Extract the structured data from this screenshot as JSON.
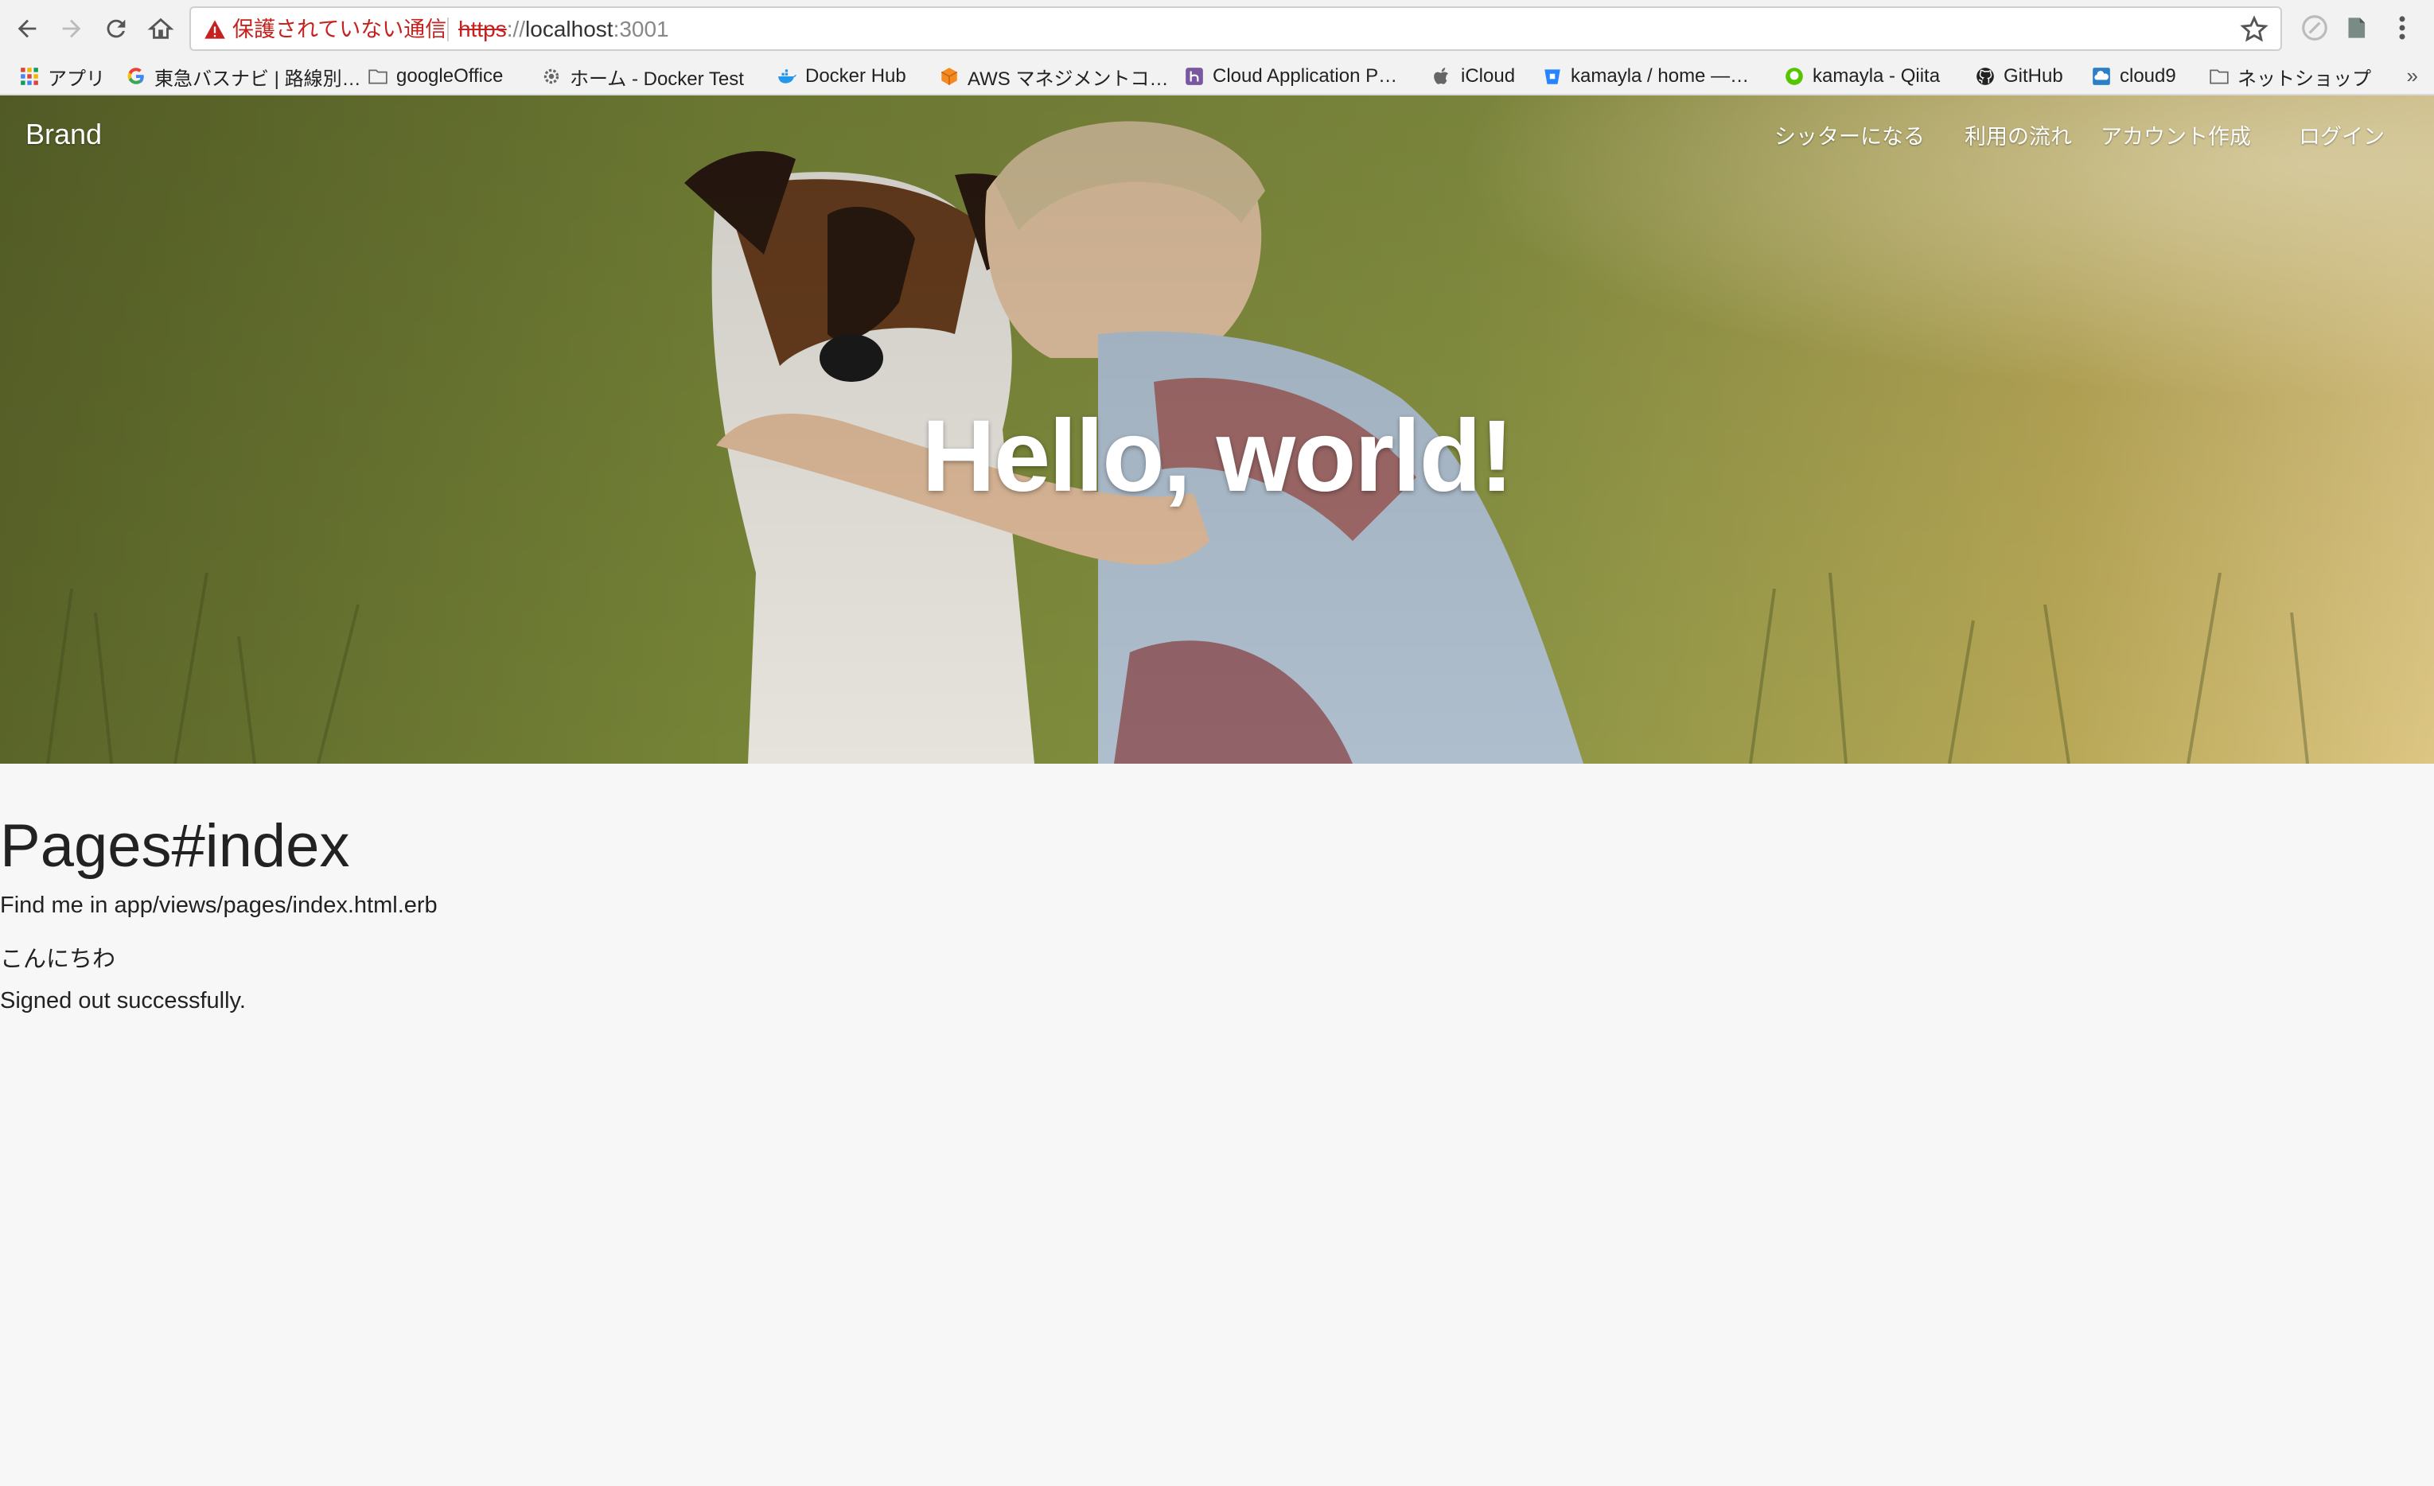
{
  "browser": {
    "security_warning": "保護されていない通信",
    "url_scheme": "https",
    "url_sep": "://",
    "url_host": "localhost",
    "url_port": ":3001"
  },
  "bookmarks": [
    {
      "label": "アプリ",
      "icon": "apps-grid-icon"
    },
    {
      "label": "東急バスナビ | 路線別…",
      "icon": "google-g-icon"
    },
    {
      "label": "googleOffice",
      "icon": "folder-icon"
    },
    {
      "label": "ホーム - Docker Test",
      "icon": "gear-icon"
    },
    {
      "label": "Docker Hub",
      "icon": "docker-whale-icon"
    },
    {
      "label": "AWS マネジメントコ…",
      "icon": "aws-cube-icon"
    },
    {
      "label": "Cloud Application P…",
      "icon": "heroku-icon"
    },
    {
      "label": "iCloud",
      "icon": "apple-icon"
    },
    {
      "label": "kamayla / home —…",
      "icon": "bitbucket-icon"
    },
    {
      "label": "kamayla - Qiita",
      "icon": "qiita-icon"
    },
    {
      "label": "GitHub",
      "icon": "github-octocat-icon"
    },
    {
      "label": "cloud9",
      "icon": "cloud9-icon"
    },
    {
      "label": "ネットショップ",
      "icon": "folder-icon"
    }
  ],
  "bookmarks_more": "»",
  "site": {
    "brand": "Brand",
    "nav": [
      "シッターになる",
      "利用の流れ",
      "アカウント作成",
      "ログイン"
    ],
    "hero_title": "Hello, world!"
  },
  "page": {
    "heading": "Pages#index",
    "paragraphs": [
      "Find me in app/views/pages/index.html.erb",
      "こんにちわ",
      "Signed out successfully."
    ]
  },
  "colors": {
    "warning_red": "#c5221f",
    "page_bg": "#f7f7f7",
    "hero_text": "#ffffff"
  }
}
